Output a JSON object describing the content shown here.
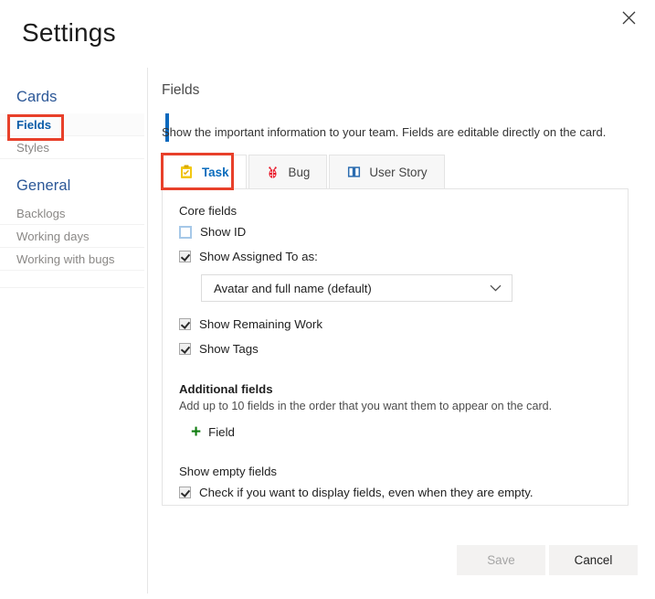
{
  "window": {
    "title": "Settings",
    "close_icon": "close-icon"
  },
  "sidebar": {
    "groups": [
      {
        "title": "Cards",
        "items": [
          {
            "label": "Fields",
            "selected": true
          },
          {
            "label": "Styles",
            "selected": false
          }
        ]
      },
      {
        "title": "General",
        "items": [
          {
            "label": "Backlogs",
            "selected": false
          },
          {
            "label": "Working days",
            "selected": false
          },
          {
            "label": "Working with bugs",
            "selected": false
          }
        ]
      }
    ]
  },
  "content": {
    "title": "Fields",
    "description": "Show the important information to your team. Fields are editable directly on the card."
  },
  "tabs": [
    {
      "label": "Task",
      "icon": "clipboard-task-icon",
      "active": true
    },
    {
      "label": "Bug",
      "icon": "ladybug-icon",
      "active": false
    },
    {
      "label": "User Story",
      "icon": "book-icon",
      "active": false
    }
  ],
  "panel": {
    "core_fields": {
      "label": "Core fields",
      "show_id": {
        "label": "Show ID",
        "checked": false
      },
      "show_assigned_to": {
        "label": "Show Assigned To as:",
        "checked": true
      },
      "assigned_to_select": {
        "value": "Avatar and full name (default)",
        "chevron_icon": "chevron-down-icon"
      },
      "show_remaining_work": {
        "label": "Show Remaining Work",
        "checked": true
      },
      "show_tags": {
        "label": "Show Tags",
        "checked": true
      }
    },
    "additional_fields": {
      "label": "Additional fields",
      "description": "Add up to 10 fields in the order that you want them to appear on the card.",
      "add_button": {
        "label": "Field",
        "icon": "plus-icon"
      }
    },
    "show_empty_fields": {
      "label": "Show empty fields",
      "checkbox": {
        "label": "Check if you want to display fields, even when they are empty.",
        "checked": true
      }
    }
  },
  "footer": {
    "save_label": "Save",
    "save_enabled": false,
    "cancel_label": "Cancel"
  },
  "colors": {
    "accent_blue": "#0a69bd",
    "link_blue": "#2b5797",
    "annotation_red": "#e8402a",
    "plus_green": "#107c10",
    "bug_red": "#e81123",
    "task_yellow": "#f2c811"
  }
}
